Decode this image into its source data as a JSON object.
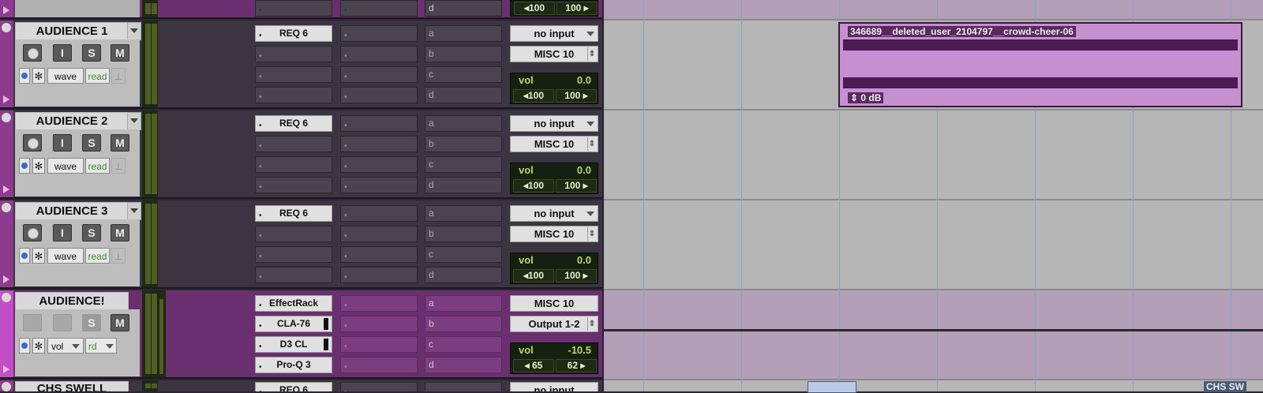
{
  "tracks": [
    {
      "name": "AUDIENCE 1",
      "buttons": {
        "rec": "",
        "input": "I",
        "solo": "S",
        "mute": "M"
      },
      "view": "wave",
      "automation": "read",
      "inserts": [
        "REQ 6",
        "",
        "",
        ""
      ],
      "sends": [
        "a",
        "b",
        "c",
        "d"
      ],
      "input": "no input",
      "output": "MISC 10",
      "vol_label": "vol",
      "vol": "0.0",
      "pan_left": "◂100",
      "pan_right": "100 ▸"
    },
    {
      "name": "AUDIENCE 2",
      "buttons": {
        "rec": "",
        "input": "I",
        "solo": "S",
        "mute": "M"
      },
      "view": "wave",
      "automation": "read",
      "inserts": [
        "REQ 6",
        "",
        "",
        ""
      ],
      "sends": [
        "a",
        "b",
        "c",
        "d"
      ],
      "input": "no input",
      "output": "MISC 10",
      "vol_label": "vol",
      "vol": "0.0",
      "pan_left": "◂100",
      "pan_right": "100 ▸"
    },
    {
      "name": "AUDIENCE 3",
      "buttons": {
        "rec": "",
        "input": "I",
        "solo": "S",
        "mute": "M"
      },
      "view": "wave",
      "automation": "read",
      "inserts": [
        "REQ 6",
        "",
        "",
        ""
      ],
      "sends": [
        "a",
        "b",
        "c",
        "d"
      ],
      "input": "no input",
      "output": "MISC 10",
      "vol_label": "vol",
      "vol": "0.0",
      "pan_left": "◂100",
      "pan_right": "100 ▸"
    },
    {
      "name": "AUDIENCE!",
      "buttons": {
        "solo": "S",
        "mute": "M"
      },
      "view": "vol",
      "automation": "rd",
      "inserts": [
        "EffectRack",
        "CLA-76",
        "D3 CL",
        "Pro-Q 3"
      ],
      "sends": [
        "a",
        "b",
        "c",
        "d"
      ],
      "input": "MISC 10",
      "output": "Output 1-2",
      "vol_label": "vol",
      "vol": "-10.5",
      "pan_left": "◂ 65",
      "pan_right": "62 ▸"
    }
  ],
  "top_partial": {
    "send": "d",
    "pan_left": "◂100",
    "pan_right": "100 ▸"
  },
  "bottom_partial": {
    "name": "CHS SWELL",
    "insert": "REQ 6",
    "input": "no input"
  },
  "clip": {
    "title": "346689__deleted_user_2104797__crowd-cheer-06",
    "gain": "0 dB"
  },
  "bottom_clip_badge": "CHS SW",
  "colors": {
    "aux_track": "#6a2f6e",
    "clip": "#c58fd0",
    "meter_green": "#4e5f20",
    "vol_text": "#b8d86a"
  }
}
